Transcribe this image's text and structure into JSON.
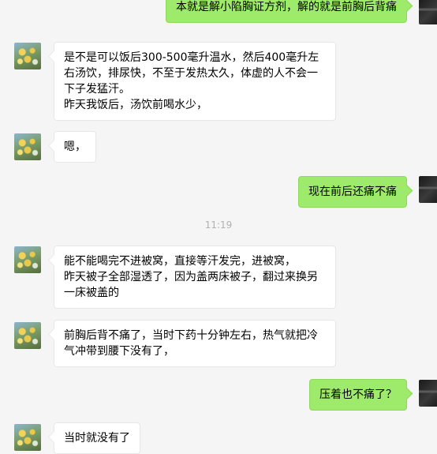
{
  "messages": [
    {
      "id": "m0",
      "sender": "me",
      "text": "本就是解小陷胸证方剂，解的就是前胸后背痛"
    },
    {
      "id": "m1",
      "sender": "contact",
      "text": "是不是可以饭后300-500毫升温水，然后400毫升左右汤饮，排尿快，不至于发热太久，体虚的人不会一下子发猛汗。\n昨天我饭后，汤饮前喝水少，"
    },
    {
      "id": "m2",
      "sender": "contact",
      "text": "嗯，"
    },
    {
      "id": "m3",
      "sender": "me",
      "text": "现在前后还痛不痛"
    },
    {
      "id": "m4",
      "sender": "contact",
      "text": "能不能喝完不进被窝，直接等汗发完，进被窝，\n昨天被子全部湿透了，因为盖两床被子，翻过来换另一床被盖的"
    },
    {
      "id": "m5",
      "sender": "contact",
      "text": "前胸后背不痛了，当时下药十分钟左右，热气就把冷气冲带到腰下没有了，"
    },
    {
      "id": "m6",
      "sender": "me",
      "text": "压着也不痛了？"
    },
    {
      "id": "m7",
      "sender": "contact",
      "text": "当时就没有了"
    }
  ],
  "timestamp": "11:19",
  "colors": {
    "out_bubble": "#9eea6a",
    "in_bubble": "#ffffff",
    "background": "#f5f5f5",
    "timestamp": "#b2b2b2"
  },
  "icons": {
    "contact_avatar": "sunflower-avatar-icon",
    "me_avatar": "dark-avatar-icon"
  }
}
